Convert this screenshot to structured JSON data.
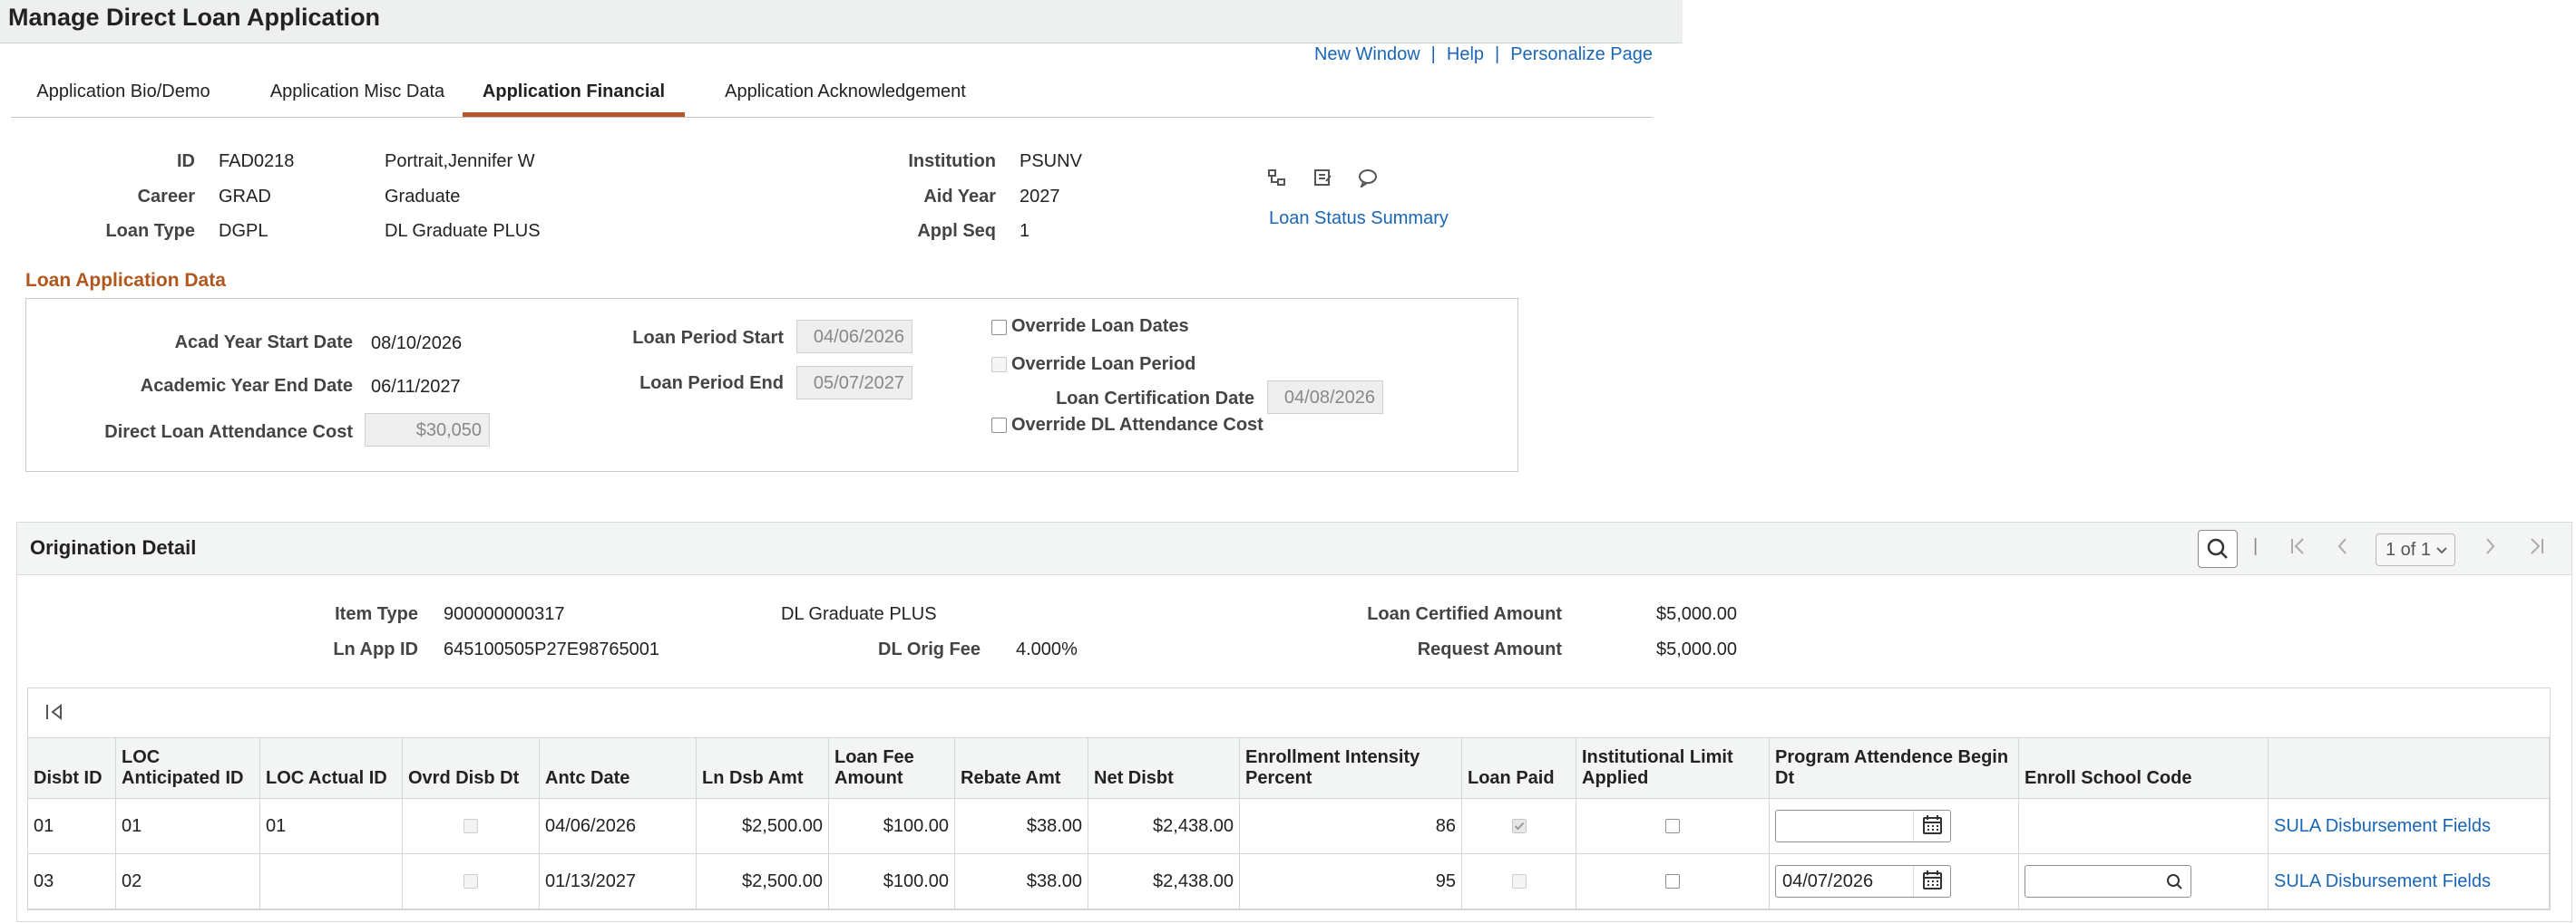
{
  "page": {
    "title": "Manage Direct Loan Application",
    "links": {
      "new_window": "New Window",
      "help": "Help",
      "personalize": "Personalize Page",
      "sep": "|"
    }
  },
  "tabs": [
    {
      "label": "Application Bio/Demo"
    },
    {
      "label": "Application Misc Data"
    },
    {
      "label": "Application Financial"
    },
    {
      "label": "Application Acknowledgement"
    }
  ],
  "header": {
    "id_label": "ID",
    "id": "FAD0218",
    "name": "Portrait,Jennifer W",
    "career_label": "Career",
    "career": "GRAD",
    "career_desc": "Graduate",
    "loan_type_label": "Loan Type",
    "loan_type": "DGPL",
    "loan_type_desc": "DL Graduate PLUS",
    "institution_label": "Institution",
    "institution": "PSUNV",
    "aid_year_label": "Aid Year",
    "aid_year": "2027",
    "appl_seq_label": "Appl Seq",
    "appl_seq": "1",
    "loan_status_link": "Loan Status Summary",
    "icons": [
      "tree-icon",
      "notepad-icon",
      "comment-icon"
    ]
  },
  "loan_app": {
    "title": "Loan Application Data",
    "acad_start_label": "Acad Year Start Date",
    "acad_start": "08/10/2026",
    "acad_end_label": "Academic Year End Date",
    "acad_end": "06/11/2027",
    "attendance_cost_label": "Direct Loan Attendance Cost",
    "attendance_cost": "$30,050",
    "period_start_label": "Loan Period Start",
    "period_start": "04/06/2026",
    "period_end_label": "Loan Period End",
    "period_end": "05/07/2027",
    "override_dates_label": "Override Loan Dates",
    "override_period_label": "Override Loan Period",
    "cert_date_label": "Loan Certification Date",
    "cert_date": "04/08/2026",
    "override_cost_label": "Override DL Attendance Cost"
  },
  "origination": {
    "title": "Origination Detail",
    "pager": "1 of 1",
    "item_type_label": "Item Type",
    "item_type": "900000000317",
    "item_desc": "DL Graduate PLUS",
    "ln_app_id_label": "Ln App ID",
    "ln_app_id": "645100505P27E98765001",
    "orig_fee_label": "DL Orig Fee",
    "orig_fee": "4.000",
    "orig_fee_unit": "%",
    "certified_label": "Loan Certified Amount",
    "certified": "$5,000.00",
    "request_label": "Request Amount",
    "request": "$5,000.00",
    "columns": [
      "Disbt ID",
      "LOC Anticipated ID",
      "LOC Actual ID",
      "Ovrd Disb Dt",
      "Antc Date",
      "Ln Dsb Amt",
      "Loan Fee Amount",
      "Rebate Amt",
      "Net Disbt",
      "Enrollment Intensity Percent",
      "Loan Paid",
      "Institutional Limit Applied",
      "Program Attendence Begin Dt",
      "Enroll School Code",
      ""
    ],
    "rows": [
      {
        "disbt_id": "01",
        "loc_ant": "01",
        "loc_act": "01",
        "antc_date": "04/06/2026",
        "ln_dsb": "$2,500.00",
        "fee": "$100.00",
        "rebate": "$38.00",
        "net": "$2,438.00",
        "intensity": "86",
        "loan_paid": true,
        "prog_date": "",
        "link": "SULA Disbursement Fields"
      },
      {
        "disbt_id": "03",
        "loc_ant": "02",
        "loc_act": "",
        "antc_date": "01/13/2027",
        "ln_dsb": "$2,500.00",
        "fee": "$100.00",
        "rebate": "$38.00",
        "net": "$2,438.00",
        "intensity": "95",
        "loan_paid": false,
        "prog_date": "04/07/2026",
        "link": "SULA Disbursement Fields"
      }
    ]
  }
}
